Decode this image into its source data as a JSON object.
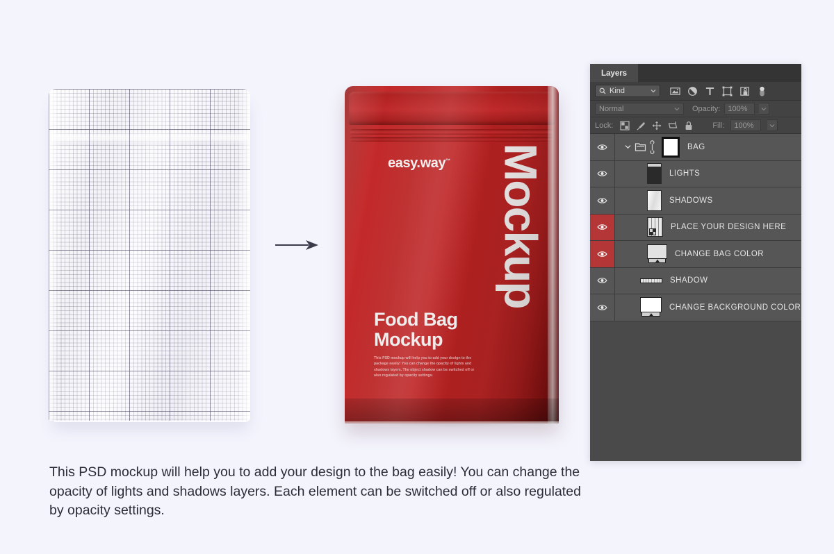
{
  "background_color": "#f4f4fd",
  "caption": "This PSD mockup will help you to add your design to the bag easily!  You can change the opacity of lights and shadows layers. Each element can be switched off or also regulated by opacity settings.",
  "template": {
    "name": "grid-template-bag",
    "description": "graph-paper grid flat bag template"
  },
  "arrow": {
    "name": "transform-arrow",
    "direction": "right"
  },
  "bag": {
    "color": "#b92627",
    "logo_text": "easy.way",
    "logo_tm": "™",
    "vertical_word": "Mockup",
    "headline": "Food Bag\nMockup",
    "body_copy": "This PSD mockup will help you to add your design to the package easily! You can change the opacity of lights and shadows layers. The object shadow can be switched off or also regulated by opacity settings."
  },
  "panel": {
    "tab_label": "Layers",
    "filter": {
      "kind_label": "Kind",
      "search_icon": "search-icon",
      "chevron_icon": "chevron-down-icon",
      "icons": [
        "pixel-layer-filter-icon",
        "adjustment-layer-filter-icon",
        "type-layer-filter-icon",
        "shape-layer-filter-icon",
        "smart-object-filter-icon",
        "filter-toggle-switch"
      ]
    },
    "blend": {
      "mode": "Normal",
      "opacity_label": "Opacity:",
      "opacity_value": "100%"
    },
    "lock": {
      "label": "Lock:",
      "icons": [
        "lock-transparent-pixels-icon",
        "lock-image-pixels-icon",
        "lock-position-icon",
        "lock-nesting-icon",
        "lock-all-icon"
      ],
      "fill_label": "Fill:",
      "fill_value": "100%"
    },
    "layers": [
      {
        "name": "BAG",
        "type": "group",
        "visible": true,
        "selected": false,
        "eye_highlight": false,
        "thumb": "layer-mask-thumbnail",
        "has_chevron": true,
        "has_folder": true,
        "has_link": true
      },
      {
        "name": "LIGHTS",
        "type": "raster",
        "visible": true,
        "selected": false,
        "eye_highlight": false,
        "thumb": "lights-thumbnail",
        "has_chevron": false,
        "has_folder": false,
        "has_link": false
      },
      {
        "name": "SHADOWS",
        "type": "raster",
        "visible": true,
        "selected": false,
        "eye_highlight": false,
        "thumb": "shadows-thumbnail",
        "has_chevron": false,
        "has_folder": false,
        "has_link": false
      },
      {
        "name": "PLACE YOUR DESIGN HERE",
        "type": "smart-object",
        "visible": true,
        "selected": true,
        "eye_highlight": true,
        "thumb": "smart-object-grid-thumbnail",
        "has_chevron": false,
        "has_folder": false,
        "has_link": false
      },
      {
        "name": "CHANGE BAG COLOR",
        "type": "adjustment",
        "visible": true,
        "selected": true,
        "eye_highlight": true,
        "thumb": "solid-color-thumbnail",
        "has_chevron": false,
        "has_folder": false,
        "has_link": false
      },
      {
        "name": "SHADOW",
        "type": "raster",
        "visible": true,
        "selected": false,
        "eye_highlight": false,
        "thumb": "shadow-strip-thumbnail",
        "has_chevron": false,
        "has_folder": false,
        "has_link": false
      },
      {
        "name": "CHANGE BACKGROUND COLOR",
        "type": "adjustment",
        "visible": true,
        "selected": false,
        "eye_highlight": false,
        "thumb": "background-color-thumbnail",
        "has_chevron": false,
        "has_folder": false,
        "has_link": false
      }
    ]
  },
  "colors": {
    "panel_bg": "#4a4a4a",
    "row_bg": "#565656",
    "eye_highlight": "#b43636",
    "accent_red": "#b92627"
  }
}
